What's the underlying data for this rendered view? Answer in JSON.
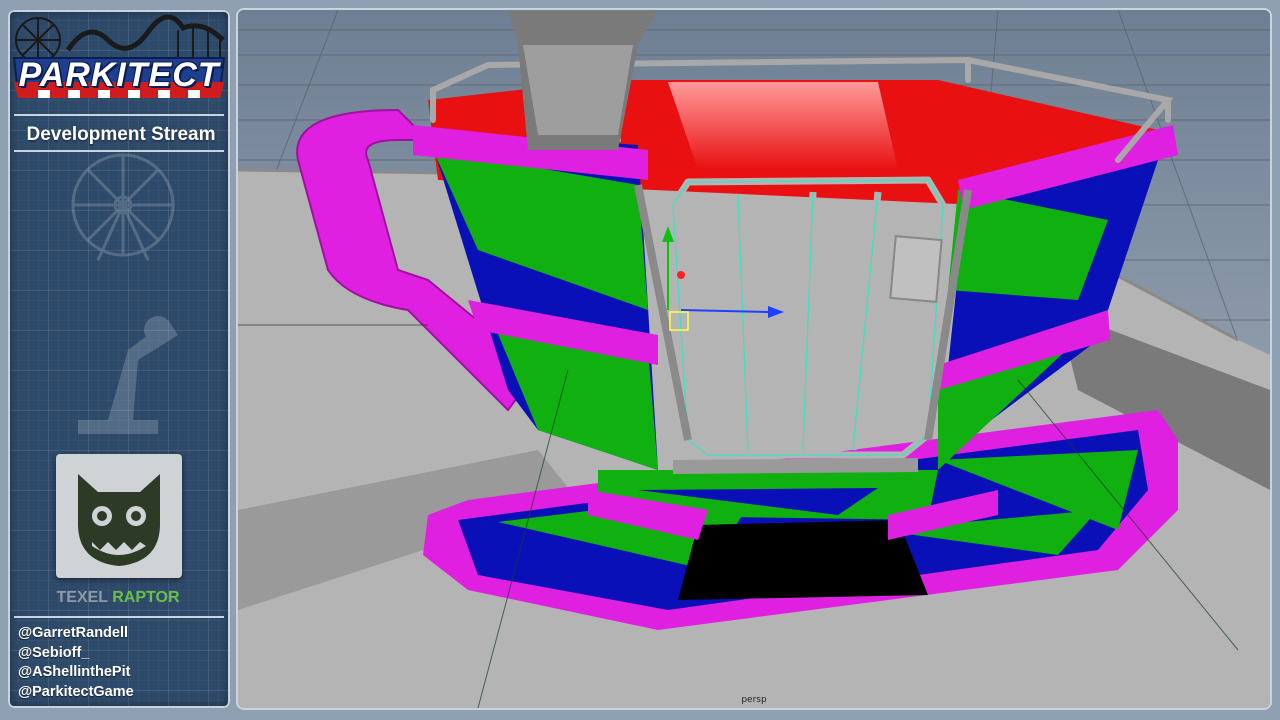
{
  "app": {
    "logo_text": "PARKITECT",
    "stream_title": "Development Stream"
  },
  "studio": {
    "name_part1": "TEXEL",
    "name_part2": "RAPTOR"
  },
  "handles": [
    "@GarretRandell",
    "@Sebioff_",
    "@AShellinthePit",
    "@ParkitectGame"
  ],
  "viewport": {
    "camera_label": "persp"
  },
  "colors": {
    "cup_magenta": "#e020e0",
    "cup_green": "#10b010",
    "cup_blue": "#0a10b8",
    "cup_red": "#e81010",
    "sidebar_bg": "#2e4a6a"
  },
  "icons": {
    "logo": "parkitect-logo",
    "studio": "raptor-head-icon",
    "background": "ferris-wheel-icon"
  }
}
